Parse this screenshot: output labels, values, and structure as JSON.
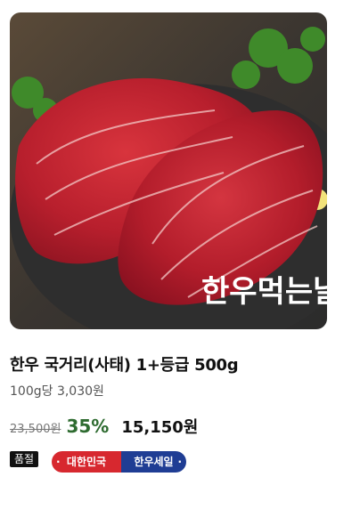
{
  "product": {
    "image_watermark": "한우먹는날",
    "name": "한우 국거리(사태) 1+등급 500g",
    "unit_price": "100g당 3,030원",
    "original_price": "23,500원",
    "discount": "35%",
    "sale_price": "15,150원",
    "status": "품절",
    "badge_left": "대한민국",
    "badge_right": "한우세일"
  }
}
